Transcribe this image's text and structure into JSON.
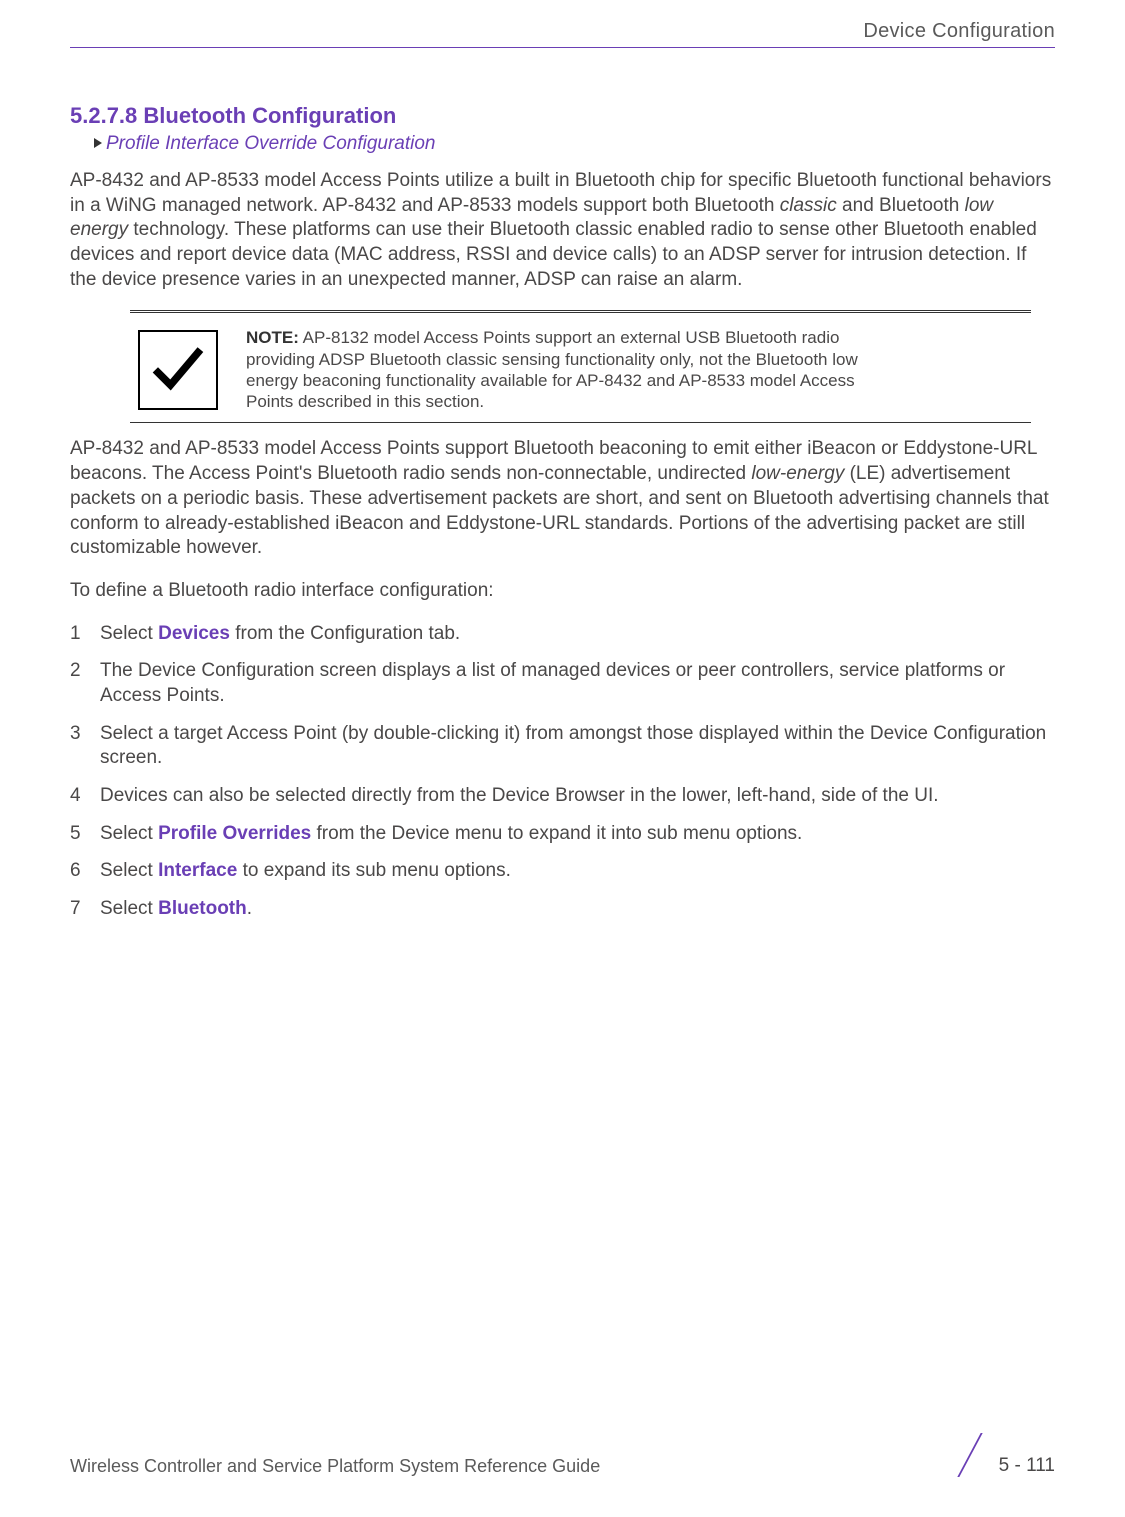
{
  "header": {
    "category": "Device Configuration"
  },
  "section": {
    "number": "5.2.7.8",
    "title": "Bluetooth Configuration",
    "breadcrumb": "Profile Interface Override Configuration"
  },
  "para1_pre": "AP-8432 and AP-8533 model Access Points utilize a built in Bluetooth chip for specific Bluetooth functional behaviors in a WiNG managed network. AP-8432 and AP-8533 models support both Bluetooth ",
  "para1_em1": "classic",
  "para1_mid": " and Bluetooth ",
  "para1_em2": "low energy",
  "para1_post": " technology. These platforms can use their Bluetooth classic enabled radio to sense other Bluetooth enabled devices and report device data (MAC address, RSSI and device calls) to an ADSP server for intrusion detection. If the device presence varies in an unexpected manner, ADSP can raise an alarm.",
  "note": {
    "label": "NOTE:",
    "text": " AP-8132 model Access Points support an external USB Bluetooth radio providing ADSP Bluetooth classic sensing functionality only, not the Bluetooth low energy beaconing functionality available for AP-8432 and AP-8533 model Access Points described in this section."
  },
  "para2_pre": "AP-8432 and AP-8533 model Access Points support Bluetooth beaconing to emit either iBeacon or Eddystone-URL beacons. The Access Point's Bluetooth radio sends non-connectable, undirected ",
  "para2_em": "low-energy",
  "para2_post": " (LE) advertisement packets on a periodic basis. These advertisement packets are short, and sent on Bluetooth advertising channels that conform to already-established iBeacon and Eddystone-URL standards. Portions of the advertising packet are still customizable however.",
  "para3": "To define a Bluetooth radio interface configuration:",
  "steps": {
    "s1_pre": "Select ",
    "s1_kw": "Devices",
    "s1_post": " from the Configuration tab.",
    "s2": "The Device Configuration screen displays a list of managed devices or peer controllers, service platforms or Access Points.",
    "s3": "Select a target Access Point (by double-clicking it) from amongst those displayed within the Device Configuration screen.",
    "s4": "Devices can also be selected directly from the Device Browser in the lower, left-hand, side of the UI.",
    "s5_pre": "Select ",
    "s5_kw": "Profile Overrides",
    "s5_post": " from the Device menu to expand it into sub menu options.",
    "s6_pre": "Select ",
    "s6_kw": "Interface",
    "s6_post": " to expand its sub menu options.",
    "s7_pre": "Select ",
    "s7_kw": "Bluetooth",
    "s7_post": "."
  },
  "footer": {
    "doc_title": "Wireless Controller and Service Platform System Reference Guide",
    "page": "5 - 111"
  }
}
